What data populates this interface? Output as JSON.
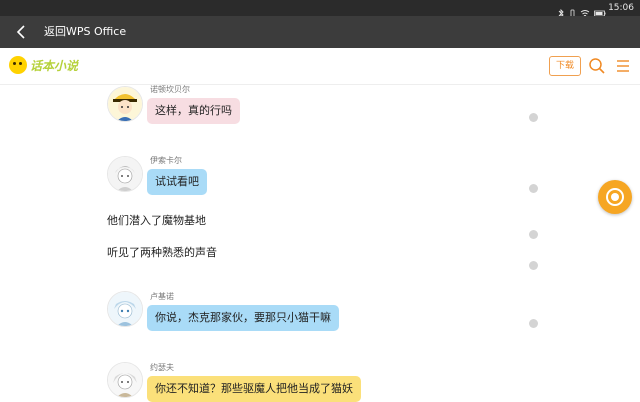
{
  "status_bar": {
    "time": "15:06"
  },
  "nav": {
    "back_title": "返回WPS Office"
  },
  "header": {
    "logo_text": "话本小说",
    "download_label": "下载"
  },
  "chat": {
    "messages": [
      {
        "speaker": "诺顿坎贝尔",
        "text": "这样，真的行吗",
        "bubble_color": "#f7dde2"
      },
      {
        "speaker": "伊索卡尔",
        "text": "试试看吧",
        "bubble_color": "#a9dbf7"
      },
      {
        "speaker": "卢基诺",
        "text": "你说，杰克那家伙，要那只小猫干嘛",
        "bubble_color": "#a9dbf7"
      },
      {
        "speaker": "约瑟夫",
        "text": "你还不知道？那些驱魔人把他当成了猫妖",
        "bubble_color": "#fbe07a"
      }
    ],
    "narration": [
      "他们潜入了魔物基地",
      "听见了两种熟悉的声音"
    ]
  },
  "colors": {
    "accent": "#f08a24",
    "fab": "#f6a623",
    "nav_bg": "#3c3c3c",
    "status_bg": "#2b2b2b"
  }
}
